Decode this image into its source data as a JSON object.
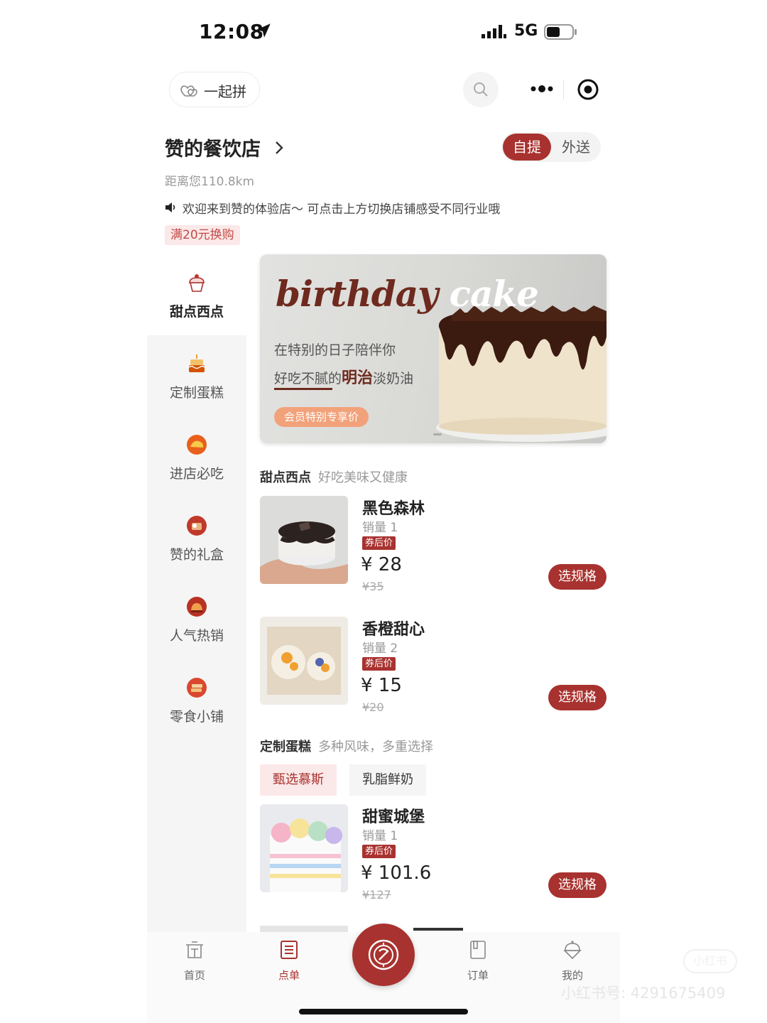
{
  "status": {
    "time": "12:08",
    "network": "5G"
  },
  "topbar": {
    "group_label": "一起拼"
  },
  "store": {
    "name": "赞的餐饮店",
    "mode_active": "自提",
    "mode_inactive": "外送",
    "distance": "距离您110.8km",
    "notice": "欢迎来到赞的体验店～ 可点击上方切换店铺感受不同行业哦",
    "promo": "满20元换购"
  },
  "sidebar": {
    "items": [
      {
        "label": "甜点西点",
        "icon": "cupcake-icon",
        "active": true
      },
      {
        "label": "定制蛋糕",
        "icon": "birthday-cake-icon",
        "active": false
      },
      {
        "label": "进店必吃",
        "icon": "must-eat-icon",
        "active": false
      },
      {
        "label": "赞的礼盒",
        "icon": "gift-box-icon",
        "active": false
      },
      {
        "label": "人气热销",
        "icon": "hot-sale-icon",
        "active": false
      },
      {
        "label": "零食小铺",
        "icon": "snack-icon",
        "active": false
      }
    ]
  },
  "banner": {
    "script_a": "birthday",
    "script_b": "cake",
    "line1": "在特别的日子陪伴你",
    "line2_pre": "好吃不腻的",
    "line2_bold": "明治",
    "line2_post": "淡奶油",
    "badge": "会员特别专享价"
  },
  "sections": [
    {
      "title": "甜点西点",
      "subtitle": "好吃美味又健康",
      "products": [
        {
          "name": "黑色森林",
          "sales": "销量 1",
          "coupon": "券后价",
          "price": "¥ 28",
          "original": "¥35",
          "button": "选规格"
        },
        {
          "name": "香橙甜心",
          "sales": "销量 2",
          "coupon": "券后价",
          "price": "¥ 15",
          "original": "¥20",
          "button": "选规格"
        }
      ]
    },
    {
      "title": "定制蛋糕",
      "subtitle": "多种风味，多重选择",
      "chips": [
        "甄选慕斯",
        "乳脂鲜奶"
      ],
      "products": [
        {
          "name": "甜蜜城堡",
          "sales": "销量 1",
          "coupon": "券后价",
          "price": "¥ 101.6",
          "original": "¥127",
          "button": "选规格"
        }
      ]
    }
  ],
  "tabbar": {
    "items": [
      {
        "label": "首页",
        "icon": "home-icon"
      },
      {
        "label": "点单",
        "icon": "menu-icon",
        "active": true
      },
      {
        "label": "订单",
        "icon": "orders-icon"
      },
      {
        "label": "我的",
        "icon": "profile-icon"
      }
    ],
    "center_icon": "store-logo-icon"
  },
  "watermark": {
    "brand": "小红书",
    "id": "小红书号: 4291675409"
  },
  "colors": {
    "accent": "#a8322f",
    "promo_bg": "#fbe8e8",
    "sidebar_bg": "#f5f5f5"
  }
}
